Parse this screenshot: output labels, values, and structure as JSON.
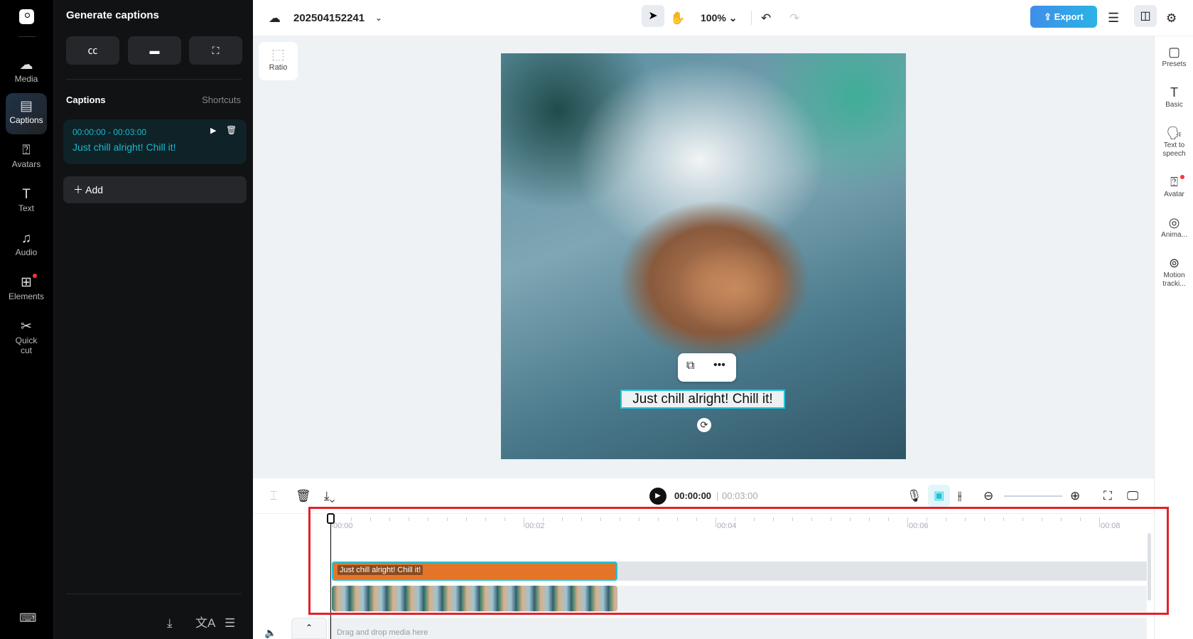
{
  "rail": {
    "items": [
      {
        "label": "Media",
        "icon": "cloud-upload-icon"
      },
      {
        "label": "Captions",
        "icon": "captions-icon",
        "active": true
      },
      {
        "label": "Avatars",
        "icon": "avatar-icon"
      },
      {
        "label": "Text",
        "icon": "text-icon"
      },
      {
        "label": "Audio",
        "icon": "music-icon"
      },
      {
        "label": "Elements",
        "icon": "elements-icon",
        "badge": true
      },
      {
        "label": "Quick cut",
        "icon": "quick-cut-icon"
      }
    ]
  },
  "panel": {
    "title": "Generate captions",
    "captions_heading": "Captions",
    "shortcuts": "Shortcuts",
    "caption": {
      "time": "00:00:00 - 00:03:00",
      "text": "Just chill alright! Chill it!"
    },
    "add": "Add"
  },
  "topbar": {
    "project": "202504152241",
    "zoom": "100%",
    "export": "Export"
  },
  "canvas": {
    "ratio": "Ratio",
    "caption_overlay": "Just chill alright! Chill it!"
  },
  "right_panel": {
    "items": [
      {
        "label": "Presets"
      },
      {
        "label": "Basic"
      },
      {
        "label": "Text to speech"
      },
      {
        "label": "Avatar",
        "badge": true
      },
      {
        "label": "Anima..."
      },
      {
        "label": "Motion tracki..."
      }
    ]
  },
  "timeline": {
    "current": "00:00:00",
    "total": "00:03:00",
    "ticks": [
      "00:00",
      "00:02",
      "00:04",
      "00:06",
      "00:08"
    ],
    "caption_clip": "Just chill alright! Chill it!",
    "drop_hint": "Drag and drop media here"
  },
  "colors": {
    "accent": "#1cc4d8",
    "clip": "#e47528",
    "export": "#3f8ee8"
  }
}
